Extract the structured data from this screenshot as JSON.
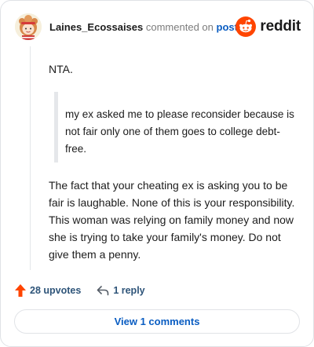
{
  "comment": {
    "username": "Laines_Ecossaises",
    "action_text": "commented on",
    "post_link_text": "post",
    "brand": "reddit",
    "paragraph_1": "NTA.",
    "quote": "my ex asked me to please reconsider because is not fair only one of them goes to college debt-free.",
    "paragraph_2": "The fact that your cheating ex is asking you to be fair is laughable. None of this is your responsibility. This woman was relying on family money and now she is trying to take your family's money. Do not give them a penny."
  },
  "actions": {
    "upvotes_label": "28 upvotes",
    "reply_label": "1 reply"
  },
  "footer": {
    "view_comments_label": "View 1 comments"
  },
  "colors": {
    "upvote_arrow": "#ff4500",
    "reddit_orange": "#ff4500",
    "link_blue": "#0a5dc2"
  },
  "icons": {
    "avatar": "user-avatar",
    "logo": "reddit-logo-icon",
    "upvote": "upvote-arrow-icon",
    "reply": "reply-arrow-icon"
  }
}
